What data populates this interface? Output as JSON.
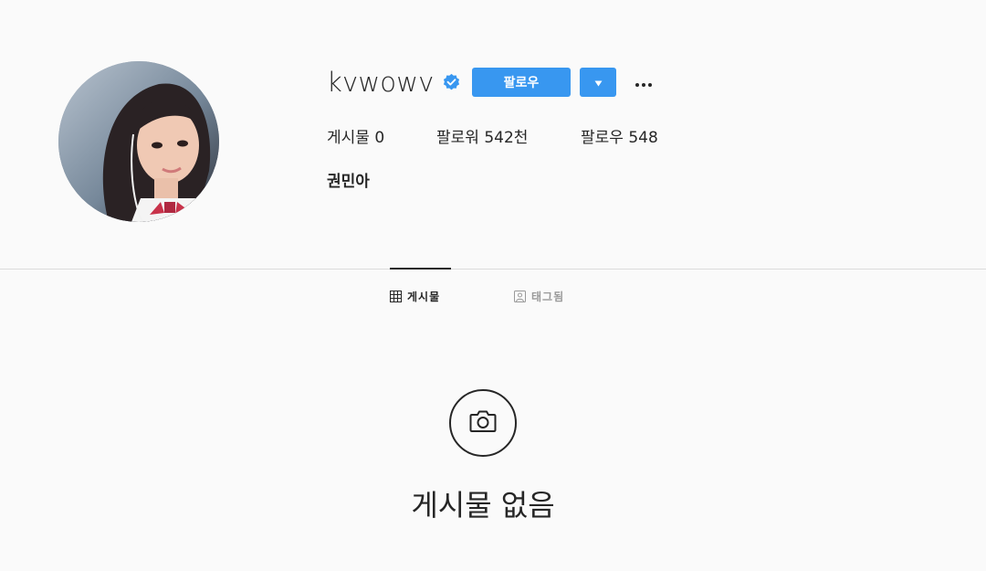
{
  "profile": {
    "username": "kvwowv",
    "full_name": "권민아",
    "verified": true,
    "verified_icon": "verified-badge-icon",
    "avatar_icon": "profile-photo"
  },
  "actions": {
    "follow_label": "팔로우",
    "dropdown_icon": "caret-down-icon",
    "more_icon": "more-horizontal-icon"
  },
  "stats": {
    "posts_label": "게시물",
    "posts_value": "0",
    "followers_label": "팔로워",
    "followers_value": "542천",
    "following_label": "팔로우",
    "following_value": "548"
  },
  "tabs": [
    {
      "label": "게시물",
      "icon": "grid-icon",
      "active": true
    },
    {
      "label": "태그됨",
      "icon": "tagged-icon",
      "active": false
    }
  ],
  "empty_state": {
    "icon": "camera-icon",
    "text": "게시물 없음"
  },
  "colors": {
    "accent": "#3897f0",
    "background": "#fafafa",
    "text": "#262626",
    "muted": "#999999",
    "divider": "#dbdbdb"
  }
}
